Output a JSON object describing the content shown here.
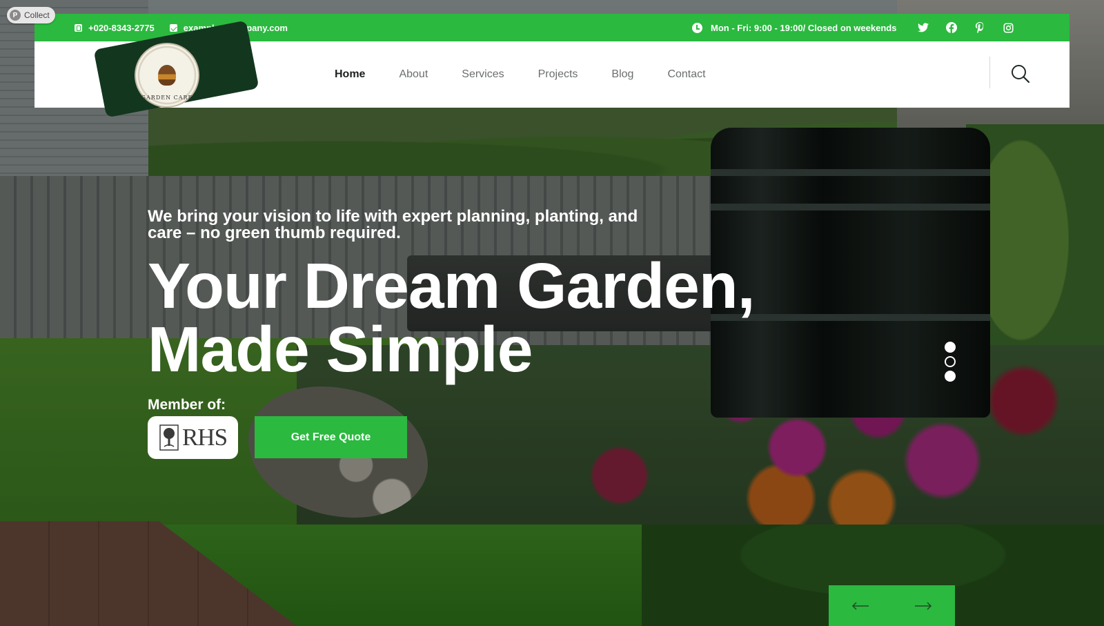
{
  "collect_badge": {
    "label": "Collect",
    "icon": "p-logo-icon"
  },
  "topbar": {
    "phone": "+020-8343-2775",
    "email": "example@company.com",
    "hours": "Mon - Fri: 9:00 - 19:00/ Closed on weekends",
    "socials": [
      "twitter-icon",
      "facebook-icon",
      "pinterest-icon",
      "instagram-icon"
    ],
    "bg_color": "#2bb93f"
  },
  "logo": {
    "icon": "garden-care-seal-logo",
    "ring_text": "GARDEN CARE"
  },
  "nav": {
    "items": [
      {
        "label": "Home",
        "active": true
      },
      {
        "label": "About"
      },
      {
        "label": "Services"
      },
      {
        "label": "Projects"
      },
      {
        "label": "Blog"
      },
      {
        "label": "Contact"
      }
    ],
    "search_icon": "search-icon"
  },
  "hero": {
    "tagline": "We bring your vision to life with expert planning, planting, and care – no green thumb required.",
    "headline_line1": "Your Dream Garden,",
    "headline_line2": "Made Simple",
    "member_label": "Member of:",
    "member_badge": "RHS",
    "cta_label": "Get Free Quote",
    "slides_total": 3,
    "slide_active": 2
  },
  "arrows": {
    "prev": "arrow-left-icon",
    "next": "arrow-right-icon"
  },
  "accent_color": "#2bb93f"
}
